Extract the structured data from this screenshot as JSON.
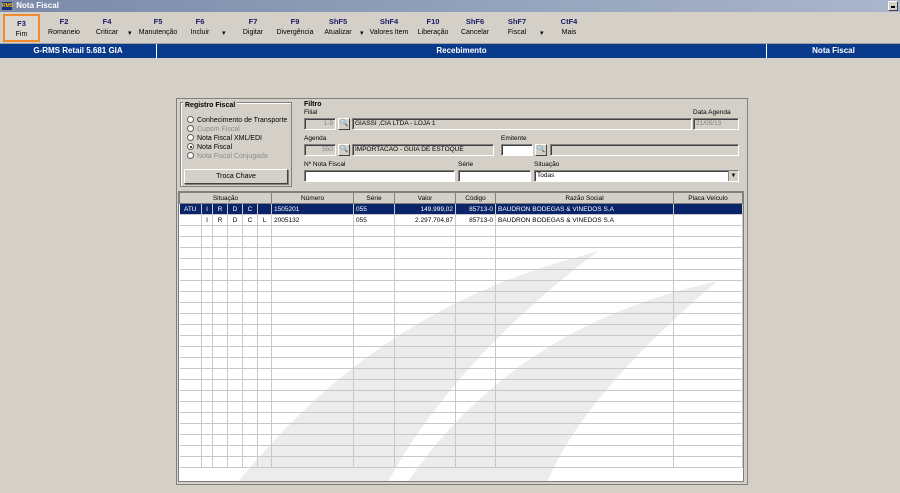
{
  "window": {
    "title": "Nota Fiscal",
    "logo_text": "RMS"
  },
  "toolbar": {
    "buttons": [
      {
        "key": "F3",
        "label": "Fim"
      },
      {
        "key": "F2",
        "label": "Romaneio"
      },
      {
        "key": "F4",
        "label": "Criticar"
      },
      {
        "key": "F5",
        "label": "Manutenção"
      },
      {
        "key": "F6",
        "label": "Incluir"
      },
      {
        "key": "F7",
        "label": "Digitar"
      },
      {
        "key": "F9",
        "label": "Divergência"
      },
      {
        "key": "ShF5",
        "label": "Atualizar"
      },
      {
        "key": "ShF4",
        "label": "Valores Item"
      },
      {
        "key": "F10",
        "label": "Liberação"
      },
      {
        "key": "ShF6",
        "label": "Cancelar"
      },
      {
        "key": "ShF7",
        "label": "Fiscal"
      },
      {
        "key": "CtF4",
        "label": "Mais"
      }
    ],
    "separator": "▾"
  },
  "statusbar": {
    "app": "G-RMS Retail 5.681 GIA",
    "module": "Recebimento",
    "screen": "Nota Fiscal"
  },
  "registro": {
    "title": "Registro Fiscal",
    "options": [
      {
        "label": "Conhecimento de Transporte",
        "checked": false,
        "disabled": false
      },
      {
        "label": "Cupom Fiscal",
        "checked": false,
        "disabled": true
      },
      {
        "label": "Nota Fiscal XML/EDI",
        "checked": false,
        "disabled": false
      },
      {
        "label": "Nota Fiscal",
        "checked": true,
        "disabled": false
      },
      {
        "label": "Nota Fiscal Conjugada",
        "checked": false,
        "disabled": true
      }
    ],
    "troca_button": "Troca Chave"
  },
  "filtro": {
    "title": "Filtro",
    "filial_label": "Filial",
    "filial_code": "1-9",
    "filial_name": "GIASSI ,CIA LTDA - LOJA 1",
    "data_agenda_label": "Data Agenda",
    "data_agenda_value": "21/05/13",
    "agenda_label": "Agenda",
    "agenda_code": "550",
    "agenda_name": "IMPORTACAO - GUIA DE ESTOQUE",
    "emitente_label": "Emitente",
    "emitente_code": "",
    "emitente_name": "",
    "nota_label": "Nº Nota Fiscal",
    "nota_value": "",
    "serie_label": "Série",
    "serie_value": "",
    "situacao_label": "Situação",
    "situacao_value": "Todas"
  },
  "grid": {
    "headers": [
      "Situação",
      "Número",
      "Série",
      "Valor",
      "Código",
      "Razão Social",
      "Placa Veículo"
    ],
    "rows": [
      {
        "s1": "ATU",
        "s2": "I",
        "s3": "R",
        "s4": "D",
        "s5": "C",
        "s6": "",
        "numero": "1505201",
        "serie": "055",
        "valor": "149.999,02",
        "codigo": "85713-0",
        "razao": "BAUDRON BODEGAS & VINEDOS S.A",
        "placa": "",
        "selected": true
      },
      {
        "s1": "",
        "s2": "I",
        "s3": "R",
        "s4": "D",
        "s5": "C",
        "s6": "L",
        "numero": "2005132",
        "serie": "055",
        "valor": "2.297.704,87",
        "codigo": "85713-0",
        "razao": "BAUDRON BODEGAS & VINEDOS S.A",
        "placa": "",
        "selected": false
      }
    ]
  },
  "colors": {
    "accent_blue": "#0a3a8c",
    "selection": "#0a246a",
    "active_outline": "#f28a2e",
    "face": "#d4d0c8"
  }
}
